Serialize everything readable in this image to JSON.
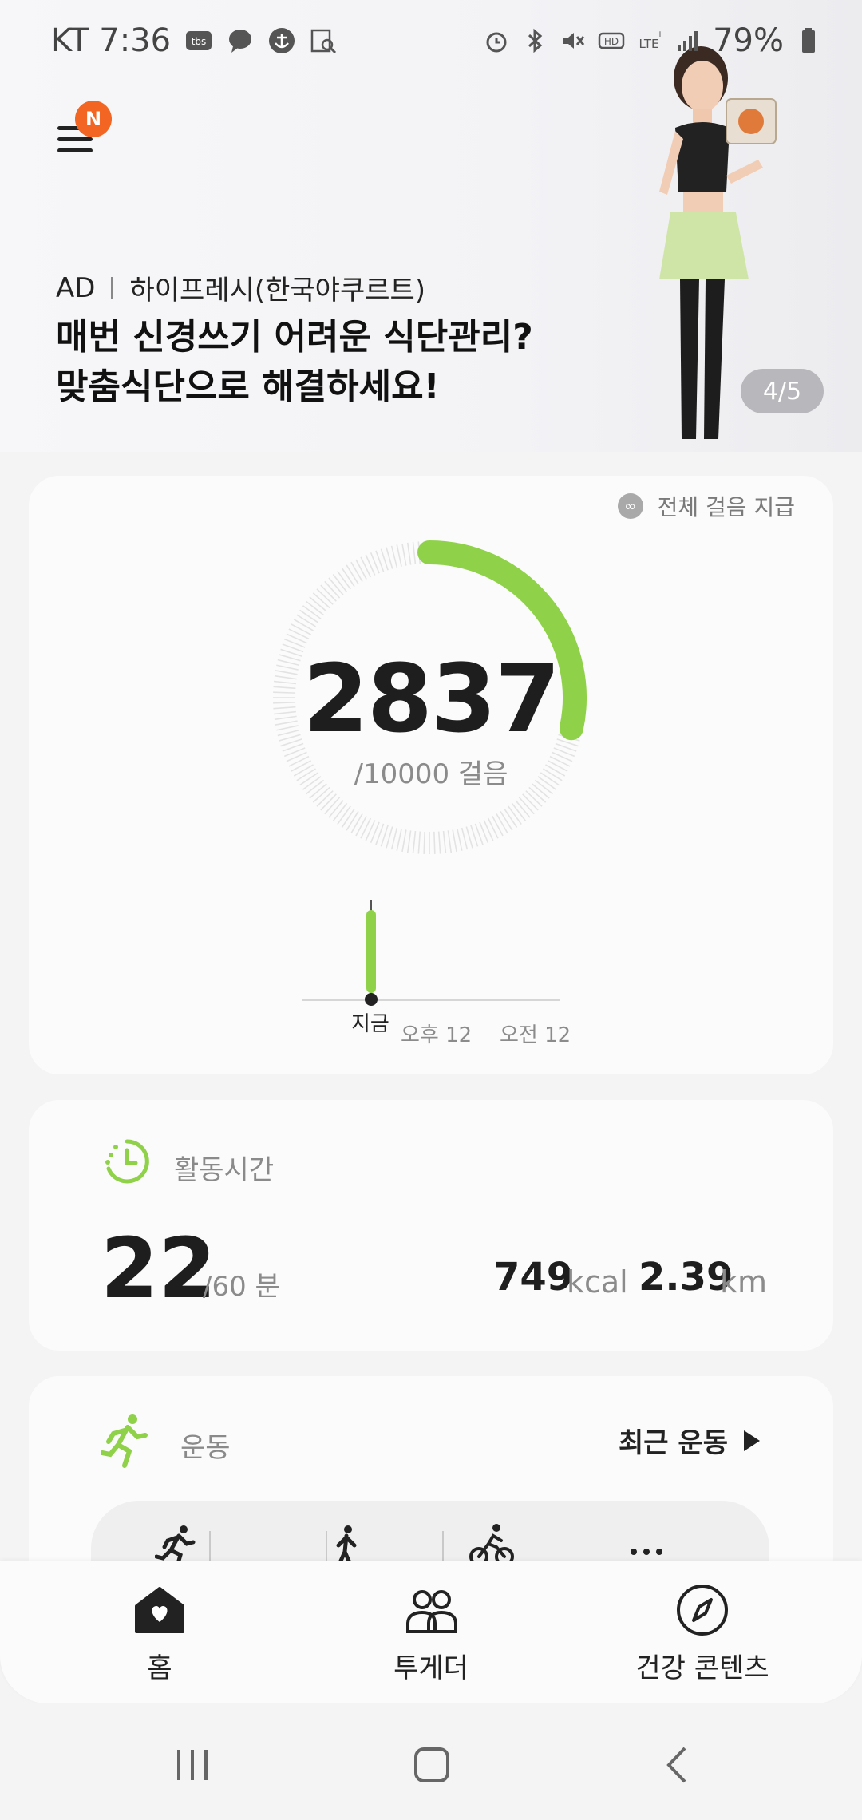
{
  "status_bar": {
    "carrier_time": "KT  7:36",
    "battery": "79%",
    "left_icons": [
      "tbs-icon",
      "chat-bubble-icon",
      "anchor-icon",
      "search-chart-icon"
    ],
    "right_icons": [
      "alarm-icon",
      "bluetooth-icon",
      "mute-icon",
      "hd-icon",
      "lte-icon",
      "signal-icon",
      "battery-icon"
    ]
  },
  "banner": {
    "menu_badge": "N",
    "ad_label": "AD",
    "advertiser": "하이프레시(한국야쿠르트)",
    "headline_1": "매번 신경쓰기 어려운 식단관리?",
    "headline_2": "맞춤식단으로 해결하세요!",
    "pager": "4/5"
  },
  "steps_card": {
    "share_label": "전체 걸음 지급",
    "steps": "2837",
    "goal_label": "/10000 걸음",
    "progress": 0.2837,
    "accent": "#8fd24a",
    "timeline_now": "지금",
    "timeline_pm": "오후 12",
    "timeline_am": "오전 12"
  },
  "active_card": {
    "title": "활동시간",
    "minutes": "22",
    "goal_label": "/60 분",
    "kcal_value": "749",
    "kcal_unit": "kcal",
    "km_value": "2.39",
    "km_unit": "km"
  },
  "exercise_card": {
    "title": "운동",
    "recent_label": "최근 운동",
    "quick_items": [
      "running-icon",
      "walking-icon",
      "cycling-icon",
      "more-icon"
    ]
  },
  "bottom_nav": {
    "home": "홈",
    "together": "투게더",
    "health_content": "건강 콘텐츠"
  }
}
